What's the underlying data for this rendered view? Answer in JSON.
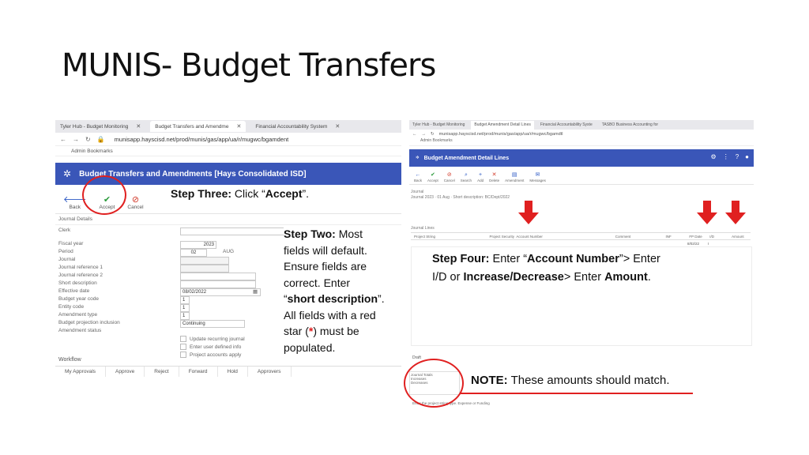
{
  "slide": {
    "title": "MUNIS- Budget Transfers"
  },
  "left_browser": {
    "tabs": [
      {
        "label": "Tyler Hub - Budget Monitoring",
        "active": false
      },
      {
        "label": "Budget Transfers and Amendme",
        "active": true
      },
      {
        "label": "Financial Accountability System",
        "active": false
      }
    ],
    "url": "munisapp.hayscisd.net/prod/munis/gas/app/ua/r/mugwc/bgamdent",
    "bookmark": "Admin Bookmarks",
    "app_title": "Budget Transfers and Amendments [Hays Consolidated ISD]",
    "toolbar": {
      "back": "Back",
      "accept": "Accept",
      "cancel": "Cancel"
    },
    "section": "Journal Details",
    "fields": {
      "clerk": "Clerk",
      "fiscal_year": "Fiscal year",
      "period": "Period",
      "journal": "Journal",
      "journal_ref1": "Journal reference 1",
      "journal_ref2": "Journal reference 2",
      "short_desc": "Short description",
      "effective_date": "Effective date",
      "budget_year_code": "Budget year code",
      "entity_code": "Entity code",
      "amendment_type": "Amendment type",
      "budget_projection": "Budget projection inclusion",
      "amendment_status": "Amendment status"
    },
    "values": {
      "fiscal_year": "2023",
      "period": "02",
      "period_month": "AUG",
      "effective_date": "08/02/2022",
      "budget_year_code": "1",
      "entity_code": "1",
      "amendment_type": "1",
      "budget_projection": "Continuing"
    },
    "checkboxes": {
      "update_recurring": "Update recurring journal",
      "enter_user_info": "Enter user defined info",
      "project_accounts": "Project accounts apply"
    },
    "workflow": {
      "label": "Workflow",
      "buttons": [
        "My Approvals",
        "Approve",
        "Reject",
        "Forward",
        "Hold",
        "Approvers"
      ]
    }
  },
  "right_browser": {
    "tabs": [
      {
        "label": "Tyler Hub - Budget Monitoring",
        "active": false
      },
      {
        "label": "Budget Amendment Detail Lines",
        "active": true
      },
      {
        "label": "Financial Accountability Syste",
        "active": false
      },
      {
        "label": "TASBO Business Accounting for",
        "active": false
      }
    ],
    "url": "munisapp.hayscisd.net/prod/munis/gas/app/ua/r/mugwc/bgamdtl",
    "bookmark": "Admin Bookmarks",
    "app_title": "Budget Amendment Detail Lines",
    "toolbar": [
      "Back",
      "Accept",
      "Cancel",
      "Search",
      "Add",
      "Delete",
      "Amendment",
      "Messages"
    ],
    "journal_label": "Journal",
    "journal_info": "Journal 2023 · 01 Aug · Short description: BC/Dept/2022",
    "grid_label": "Journal Lines",
    "columns": [
      "Project String",
      "Project Security",
      "Account Number",
      "Comment",
      "INF",
      "FP Date",
      "I/D",
      "Amount"
    ],
    "row": {
      "fp_date": "8/02/22",
      "id": "I"
    },
    "draft_label": "Draft",
    "totals_label": "Journal Totals",
    "totals_rows": [
      "Increases",
      "Decreases"
    ],
    "footer": "Enter the project string type. Expense or Funding"
  },
  "annotations": {
    "step_three": {
      "label": "Step Three:",
      "t1": " Click “",
      "accept": "Accept",
      "t2": "”."
    },
    "step_two": {
      "label": "Step Two:",
      "l1": " Most",
      "l2": "fields will default.",
      "l3": "Ensure fields are",
      "l4": "correct.  Enter",
      "l5a": "“",
      "short": "short description",
      "l5b": "”.",
      "l6": "All fields with a red",
      "l7a": "star (",
      "star": "*",
      "l7b": ") must be",
      "l8": "populated."
    },
    "step_four": {
      "label": "Step Four:",
      "t1": " Enter “",
      "account": "Account Number",
      "t2": "”> Enter",
      "t3": "I/D or ",
      "incdec": "Increase/Decrease",
      "t4": "> Enter ",
      "amount": "Amount",
      "t5": "."
    },
    "note": {
      "label": "NOTE:",
      "text": " These amounts should match."
    }
  },
  "colors": {
    "app_bar": "#3a56b8",
    "annotation_red": "#e02020"
  }
}
